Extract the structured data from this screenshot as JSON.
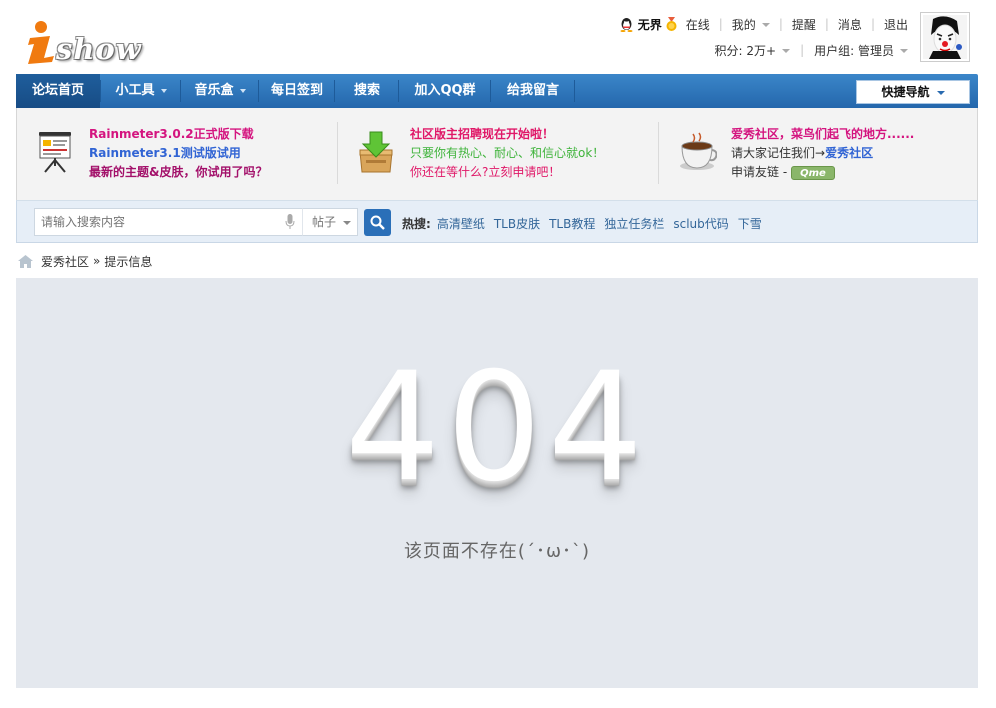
{
  "header": {
    "logo_text": "show",
    "user": {
      "name": "无界",
      "online": "在线",
      "mine": "我的",
      "reminders": "提醒",
      "messages": "消息",
      "logout": "退出",
      "points": "积分: 2万+",
      "usergroup": "用户组: 管理员"
    }
  },
  "nav": {
    "items": [
      {
        "label": "论坛首页",
        "active": true
      },
      {
        "label": "小工具",
        "dropdown": true
      },
      {
        "label": "音乐盒",
        "dropdown": true
      },
      {
        "label": "每日签到"
      },
      {
        "label": "搜索"
      },
      {
        "label": "加入QQ群"
      },
      {
        "label": "给我留言"
      }
    ],
    "quick_nav": "快捷导航"
  },
  "promo": {
    "col1": [
      "Rainmeter3.0.2正式版下载",
      "Rainmeter3.1测试版试用",
      "最新的主题&皮肤，你试用了吗？"
    ],
    "col2": [
      "社区版主招聘现在开始啦！",
      "只要你有热心、耐心、和信心就ok！",
      "你还在等什么?立刻申请吧！"
    ],
    "col3": {
      "line1": "爱秀社区，菜鸟们起飞的地方......",
      "line2_prefix": "请大家记住我们→",
      "line2_link": "爱秀社区",
      "line3_prefix": "申请友链 - ",
      "qme_badge": "Qme"
    }
  },
  "search": {
    "placeholder": "请输入搜索内容",
    "type": "帖子",
    "hot_label": "热搜:",
    "hot_items": [
      "高清壁纸",
      "TLB皮肤",
      "TLB教程",
      "独立任务栏",
      "sclub代码",
      "下雪"
    ]
  },
  "breadcrumb": {
    "home": "爱秀社区",
    "separator": "»",
    "current": "提示信息"
  },
  "error": {
    "code": "404",
    "message": "该页面不存在(´･ω･`)"
  },
  "colors": {
    "nav_blue": "#2c73b8",
    "panel_bg": "#e4e8ee",
    "logo_orange": "#f07a10",
    "promo_magenta": "#d4147f",
    "promo_blue": "#3164d4",
    "promo_green": "#3eb33a"
  }
}
